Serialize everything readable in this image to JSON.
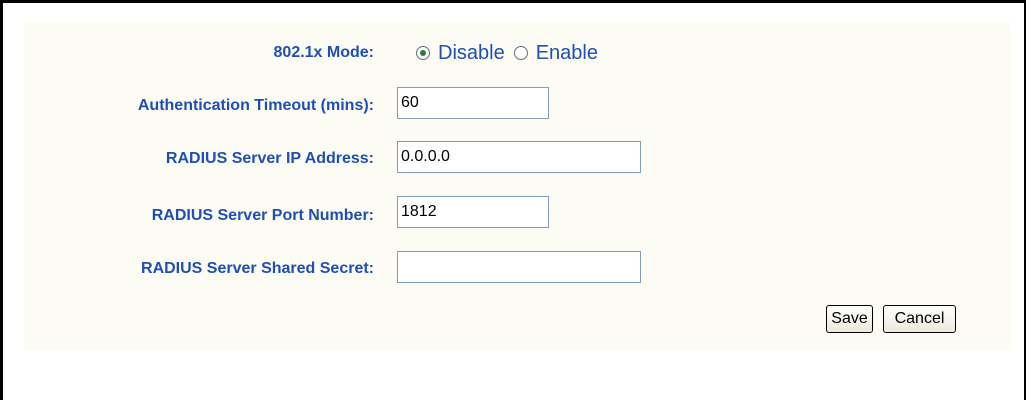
{
  "form": {
    "mode": {
      "label": "802.1x Mode:",
      "options": [
        "Disable",
        "Enable"
      ],
      "selected": "Disable"
    },
    "auth_timeout": {
      "label": "Authentication Timeout (mins):",
      "value": "60"
    },
    "radius_ip": {
      "label": "RADIUS Server IP Address:",
      "value": "0.0.0.0"
    },
    "radius_port": {
      "label": "RADIUS Server Port Number:",
      "value": "1812"
    },
    "radius_secret": {
      "label": "RADIUS Server Shared Secret:",
      "value": ""
    }
  },
  "buttons": {
    "save": "Save",
    "cancel": "Cancel"
  },
  "colors": {
    "label": "#1f4fb5",
    "panel_bg": "#fcfcf5"
  }
}
